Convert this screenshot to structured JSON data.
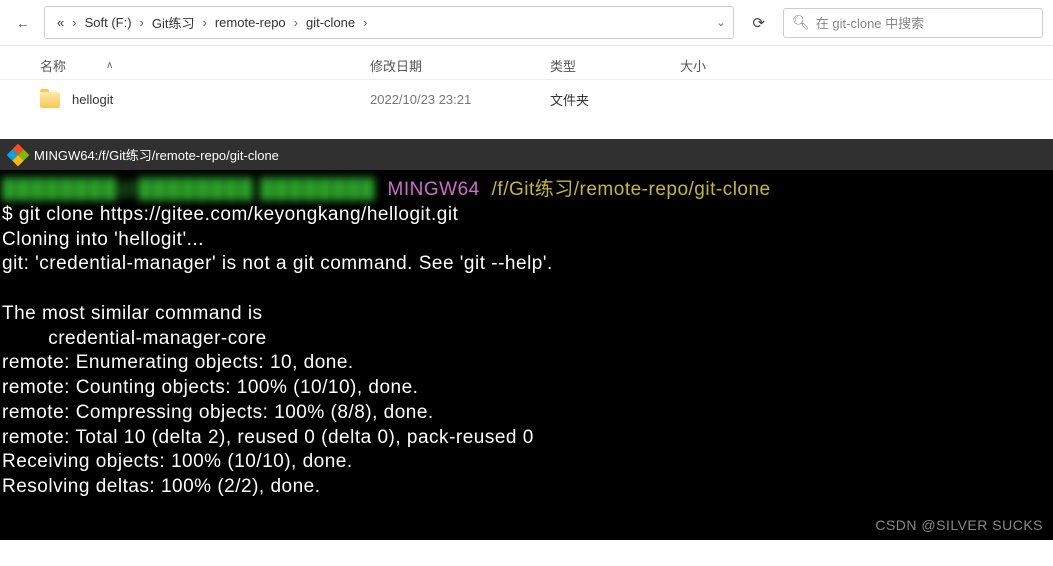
{
  "explorer": {
    "breadcrumb": [
      "«",
      "Soft (F:)",
      "Git练习",
      "remote-repo",
      "git-clone"
    ],
    "search_placeholder": "在 git-clone 中搜索",
    "columns": {
      "name": "名称",
      "date": "修改日期",
      "type": "类型",
      "size": "大小"
    },
    "rows": [
      {
        "name": "hellogit",
        "date": "2022/10/23 23:21",
        "type": "文件夹",
        "size": ""
      }
    ]
  },
  "terminal": {
    "title": "MINGW64:/f/Git练习/remote-repo/git-clone",
    "prompt_env": "MINGW64",
    "prompt_path": "/f/Git练习/remote-repo/git-clone",
    "command": "$ git clone https://gitee.com/keyongkang/hellogit.git",
    "lines": [
      "Cloning into 'hellogit'...",
      "git: 'credential-manager' is not a git command. See 'git --help'.",
      "",
      "The most similar command is",
      "        credential-manager-core",
      "remote: Enumerating objects: 10, done.",
      "remote: Counting objects: 100% (10/10), done.",
      "remote: Compressing objects: 100% (8/8), done.",
      "remote: Total 10 (delta 2), reused 0 (delta 0), pack-reused 0",
      "Receiving objects: 100% (10/10), done.",
      "Resolving deltas: 100% (2/2), done."
    ],
    "watermark": "CSDN @SILVER SUCKS"
  }
}
